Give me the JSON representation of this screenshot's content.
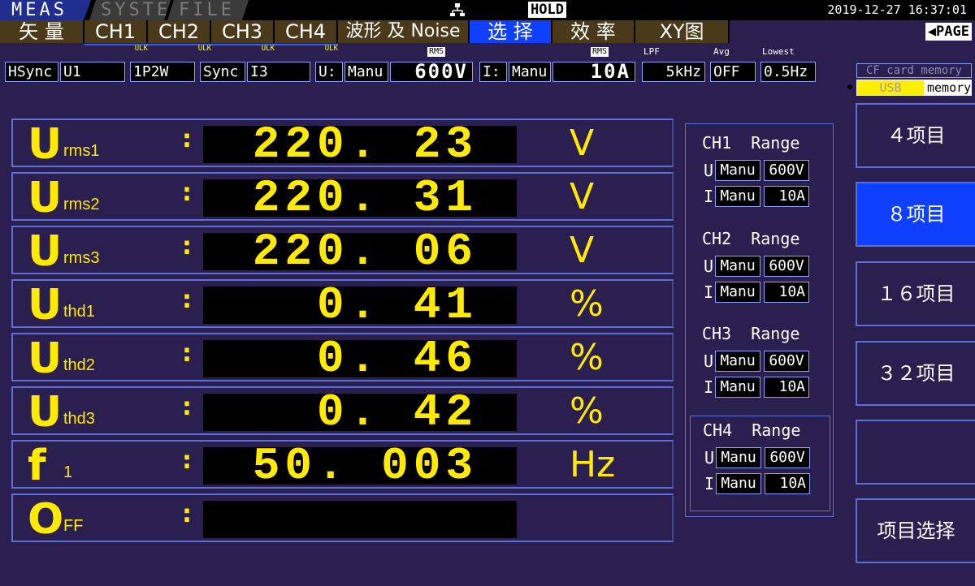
{
  "mode_tabs": {
    "meas": "MEAS",
    "system": "SYSTEM",
    "file": "FILE"
  },
  "status": {
    "hold": "HOLD",
    "datetime": "2019-12-27 16:37:01"
  },
  "screen_tabs": [
    "矢 量",
    "CH1",
    "CH2",
    "CH3",
    "CH4",
    "波形 及 Noise",
    "选 择",
    "效 率",
    "XY图"
  ],
  "active_screen_tab": "选 择",
  "page_button": "◀PAGE",
  "ulk_label": "ULK",
  "settings": {
    "hsync_label": "HSync",
    "hsync_value": "U1",
    "wiring": "1P2W",
    "sync_label": "Sync",
    "sync_value": "I3",
    "u_label": "U:",
    "u_mode": "Manu",
    "u_rms_tag": "RMS",
    "u_range": "600V",
    "i_label": "I:",
    "i_mode": "Manu",
    "i_rms_tag": "RMS",
    "i_range": "10A",
    "lpf_label": "LPF",
    "lpf_value": "5kHz",
    "avg_label": "Avg",
    "avg_value": "OFF",
    "lowest_label": "Lowest",
    "lowest_value": "0.5Hz"
  },
  "storage": {
    "cf_card": "CF card memory",
    "usb_part": "USB",
    "usb_text": "memory"
  },
  "measurements": [
    {
      "symbol": "U",
      "sub": "rms1",
      "value": "220. 23",
      "unit": "V"
    },
    {
      "symbol": "U",
      "sub": "rms2",
      "value": "220. 31",
      "unit": "V"
    },
    {
      "symbol": "U",
      "sub": "rms3",
      "value": "220. 06",
      "unit": "V"
    },
    {
      "symbol": "U",
      "sub": "thd1",
      "value": "0. 41",
      "unit": "%"
    },
    {
      "symbol": "U",
      "sub": "thd2",
      "value": "0. 46",
      "unit": "%"
    },
    {
      "symbol": "U",
      "sub": "thd3",
      "value": "0. 42",
      "unit": "%"
    },
    {
      "symbol": "f",
      "sub": "1",
      "value": "50. 003",
      "unit": "Hz"
    },
    {
      "symbol": "O",
      "sub": "FF",
      "value": "",
      "unit": ""
    }
  ],
  "colon": ":",
  "range_panel": {
    "range_label": "Range",
    "channels": [
      {
        "name": "CH1",
        "u_label": "U",
        "u_mode": "Manu",
        "u_range": "600V",
        "i_label": "I",
        "i_mode": "Manu",
        "i_range": "10A"
      },
      {
        "name": "CH2",
        "u_label": "U",
        "u_mode": "Manu",
        "u_range": "600V",
        "i_label": "I",
        "i_mode": "Manu",
        "i_range": "10A"
      },
      {
        "name": "CH3",
        "u_label": "U",
        "u_mode": "Manu",
        "u_range": "600V",
        "i_label": "I",
        "i_mode": "Manu",
        "i_range": "10A"
      },
      {
        "name": "CH4",
        "u_label": "U",
        "u_mode": "Manu",
        "u_range": "600V",
        "i_label": "I",
        "i_mode": "Manu",
        "i_range": "10A"
      }
    ]
  },
  "soft_keys": [
    {
      "label": "４项目",
      "active": false
    },
    {
      "label": "８项目",
      "active": true
    },
    {
      "label": "１６项目",
      "active": false
    },
    {
      "label": "３２项目",
      "active": false
    },
    {
      "label": "",
      "active": false
    },
    {
      "label": "项目选择",
      "active": false
    }
  ],
  "colors": {
    "background": "#2a1f4e",
    "value_yellow": "#ffea00",
    "active_blue": "#1040ff",
    "tab_brown": "#4b3a1a"
  }
}
